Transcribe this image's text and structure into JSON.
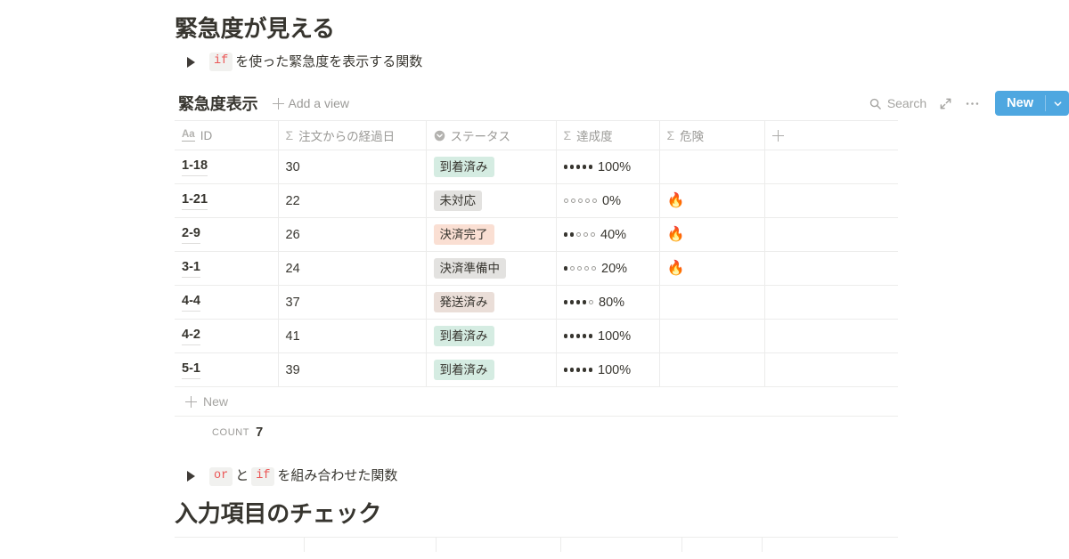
{
  "section1": {
    "heading": "緊急度が見える",
    "toggle": {
      "arrow_icon": "triangle-right-icon",
      "code": "if",
      "text": "を使った緊急度を表示する関数"
    }
  },
  "database": {
    "title": "緊急度表示",
    "add_view_label": "Add a view",
    "add_view_icon": "plus-icon",
    "search_label": "Search",
    "search_icon": "search-icon",
    "expand_icon": "expand-arrows-icon",
    "more_icon": "ellipsis-icon",
    "new_button": {
      "label": "New",
      "caret_icon": "chevron-down-icon",
      "color": "#4ea7e0"
    },
    "columns": [
      {
        "label": "ID",
        "icon": "title-text-icon",
        "type": "title"
      },
      {
        "label": "注文からの経過日",
        "icon": "formula-sigma-icon",
        "type": "formula"
      },
      {
        "label": "ステータス",
        "icon": "select-circle-icon",
        "type": "select"
      },
      {
        "label": "達成度",
        "icon": "formula-sigma-icon",
        "type": "formula"
      },
      {
        "label": "危険",
        "icon": "formula-sigma-icon",
        "type": "formula"
      },
      {
        "label": "",
        "icon": "plus-icon",
        "type": "add-column"
      }
    ],
    "rows": [
      {
        "id": "1-18",
        "days": "30",
        "status": "到着済み",
        "status_bg": "#d5ece2",
        "achievement_pct": 100,
        "achievement_label": "100%",
        "risk": ""
      },
      {
        "id": "1-21",
        "days": "22",
        "status": "未対応",
        "status_bg": "#e3e2e0",
        "achievement_pct": 0,
        "achievement_label": "0%",
        "risk": "🔥"
      },
      {
        "id": "2-9",
        "days": "26",
        "status": "決済完了",
        "status_bg": "#fadfd3",
        "achievement_pct": 40,
        "achievement_label": "40%",
        "risk": "🔥"
      },
      {
        "id": "3-1",
        "days": "24",
        "status": "決済準備中",
        "status_bg": "#e3e2e0",
        "achievement_pct": 20,
        "achievement_label": "20%",
        "risk": "🔥"
      },
      {
        "id": "4-4",
        "days": "37",
        "status": "発送済み",
        "status_bg": "#eaded8",
        "achievement_pct": 80,
        "achievement_label": "80%",
        "risk": ""
      },
      {
        "id": "4-2",
        "days": "41",
        "status": "到着済み",
        "status_bg": "#d5ece2",
        "achievement_pct": 100,
        "achievement_label": "100%",
        "risk": ""
      },
      {
        "id": "5-1",
        "days": "39",
        "status": "到着済み",
        "status_bg": "#d5ece2",
        "achievement_pct": 100,
        "achievement_label": "100%",
        "risk": ""
      }
    ],
    "new_row_label": "New",
    "new_row_icon": "plus-icon",
    "count_label": "COUNT",
    "count_value": "7"
  },
  "section2": {
    "toggle": {
      "arrow_icon": "triangle-right-icon",
      "code1": "or",
      "mid_text": "と",
      "code2": "if",
      "text": "を組み合わせた関数"
    },
    "heading": "入力項目のチェック"
  }
}
